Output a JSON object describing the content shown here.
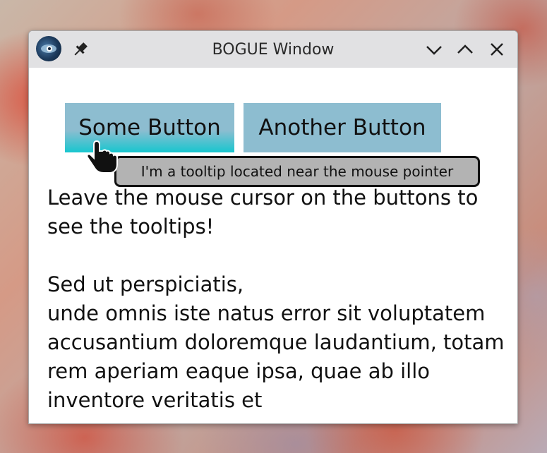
{
  "window": {
    "title": "BOGUE Window",
    "icons": {
      "app": "bogue-app-icon",
      "pin": "pin-icon",
      "minimize": "chevron-down-icon",
      "maximize": "chevron-up-icon",
      "close": "close-icon"
    }
  },
  "buttons": {
    "some_button": "Some Button",
    "another_button": "Another Button"
  },
  "body": {
    "intro": "Leave the mouse cursor on the buttons to see the tooltips!",
    "lorem_line1": "Sed ut perspiciatis,",
    "lorem_rest": "unde omnis iste natus error sit voluptatem accusantium doloremque laudantium, totam rem aperiam eaque ipsa, quae ab illo inventore veritatis et"
  },
  "tooltip": {
    "text": "I'm a tooltip located near the mouse pointer"
  },
  "colors": {
    "button_bg": "#8dbdd0",
    "button_hover_accent": "#17c6cf",
    "tooltip_bg": "#b3b3b3",
    "titlebar_bg": "#e1e1e3"
  }
}
